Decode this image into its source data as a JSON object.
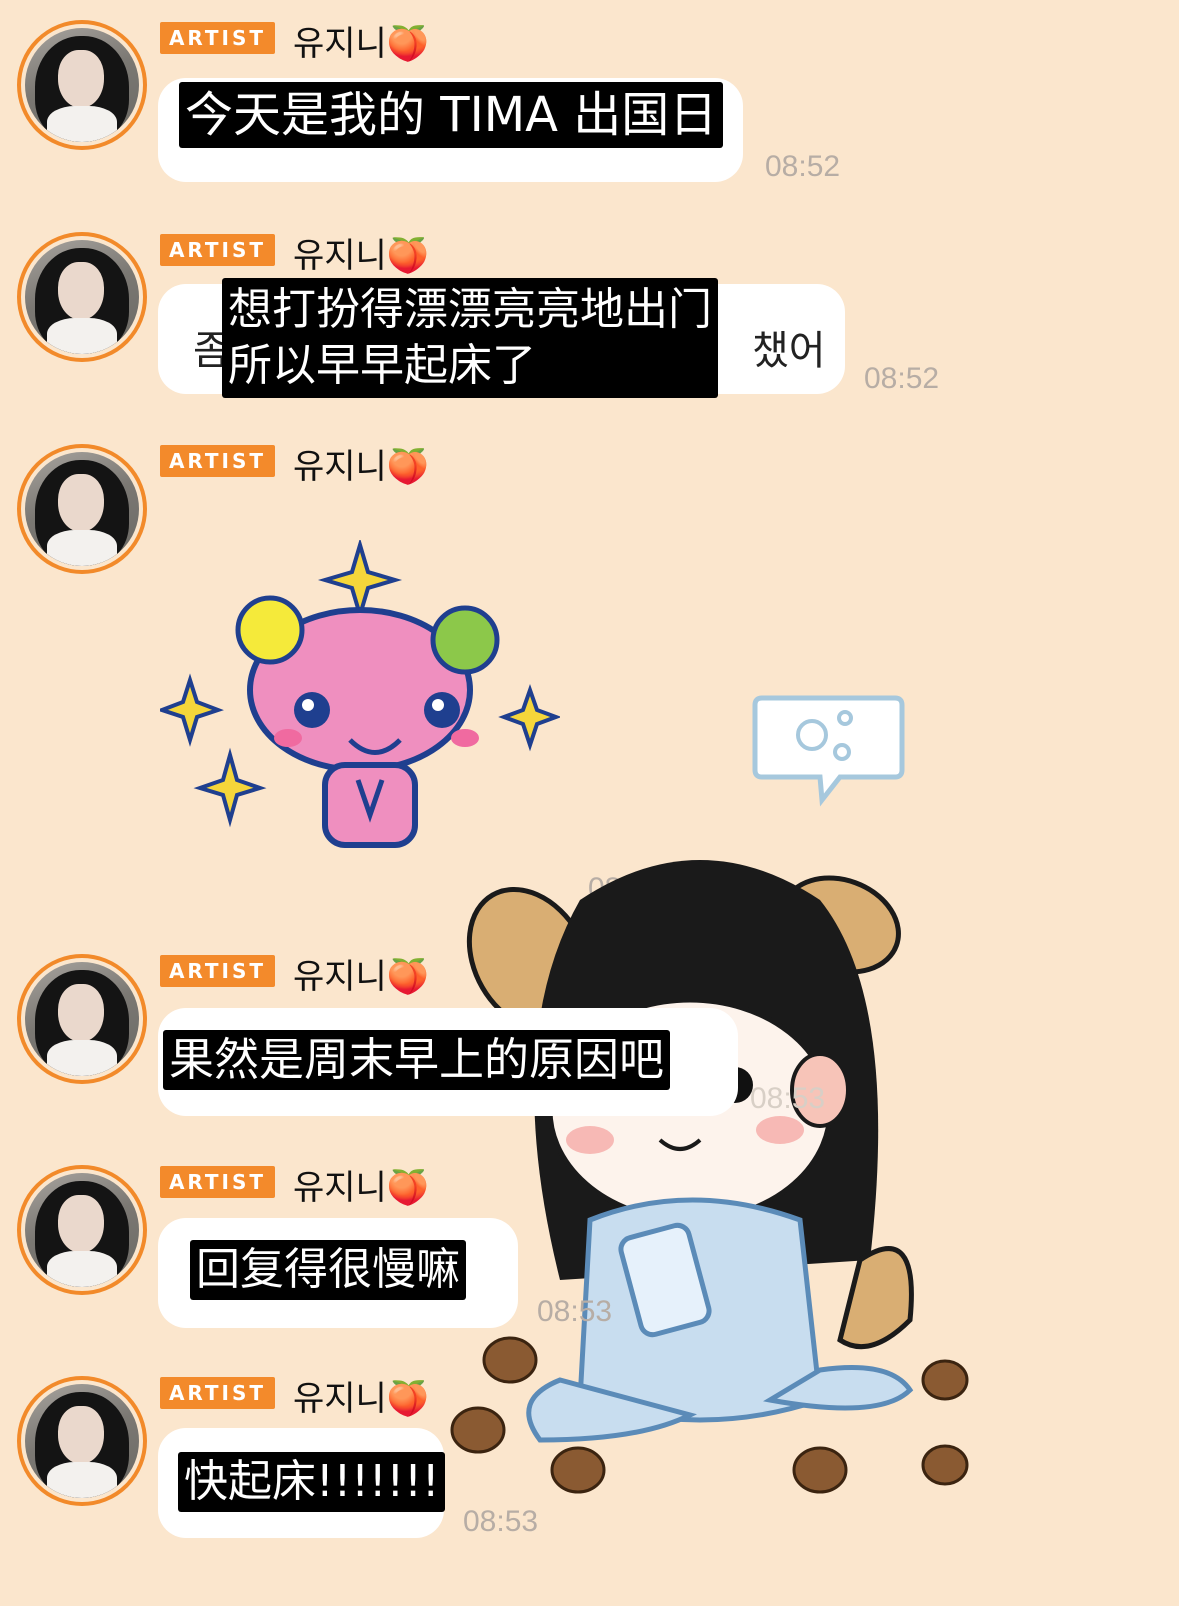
{
  "chat": {
    "badge_label": "ARTIST",
    "sender_name": "유지니🍑",
    "messages": [
      {
        "subtitle": "今天是我的 TIMA 出国日",
        "time": "08:52"
      },
      {
        "subtitle": "想打扮得漂漂亮亮地出门\n所以早早起床了",
        "time": "08:52",
        "partial_left": "좀",
        "partial_right": "챘어"
      },
      {
        "type": "sticker",
        "time": "08:52"
      },
      {
        "subtitle": "果然是周末早上的原因吧",
        "time": "08:53"
      },
      {
        "subtitle": "回复得很慢嘛",
        "time": "08:53"
      },
      {
        "subtitle": "快起床!!!!!!!",
        "time": "08:53"
      }
    ]
  },
  "colors": {
    "background": "#fbe6cd",
    "badge": "#f38a2b",
    "bubble": "#ffffff",
    "subtitle_bg": "#000000"
  }
}
